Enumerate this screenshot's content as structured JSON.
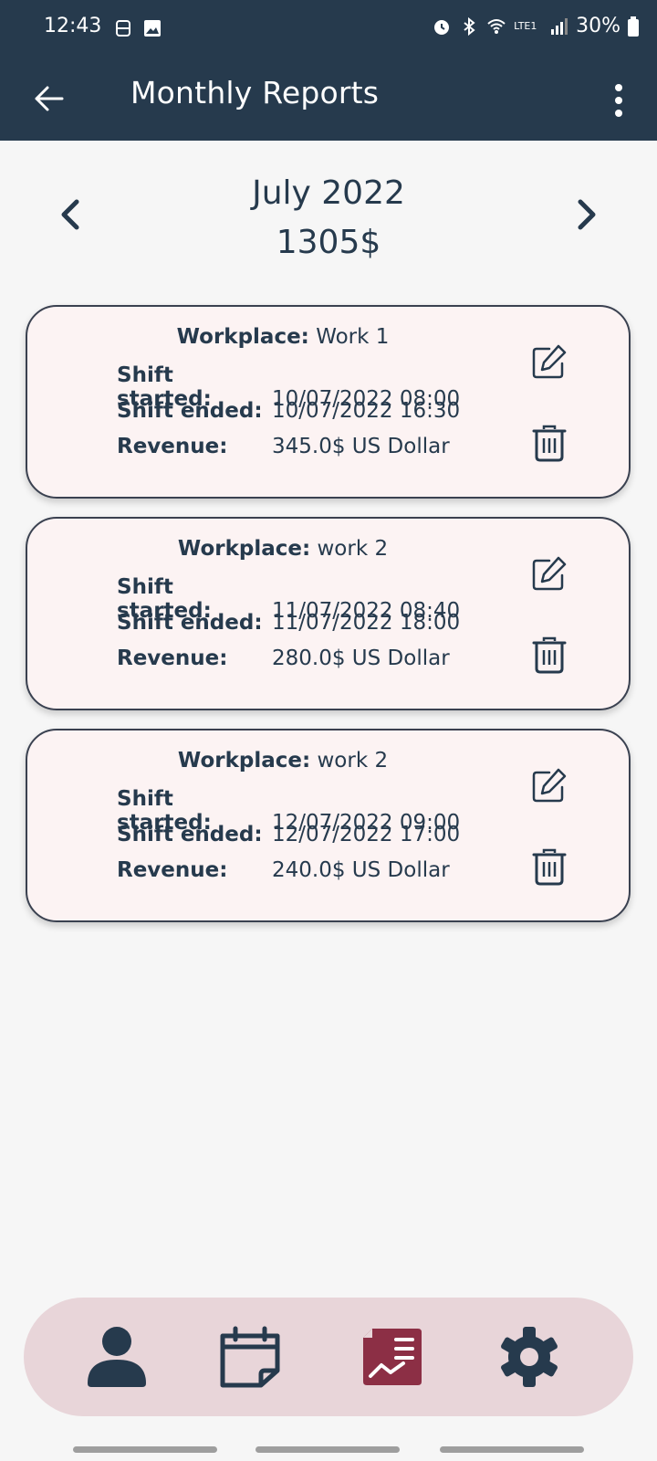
{
  "status_bar": {
    "time": "12:43",
    "battery": "30%",
    "net": "LTE1"
  },
  "app_bar": {
    "title": "Monthly Reports"
  },
  "month_nav": {
    "month": "July 2022",
    "total": "1305$"
  },
  "labels": {
    "workplace": "Workplace:",
    "shift_started": "Shift started:",
    "shift_ended": "Shift ended:",
    "revenue": "Revenue:"
  },
  "shifts": [
    {
      "workplace": "Work 1",
      "started": "10/07/2022  08:00",
      "ended": "10/07/2022  16:30",
      "revenue": "345.0$  US Dollar"
    },
    {
      "workplace": "work 2",
      "started": "11/07/2022  08:40",
      "ended": "11/07/2022  18:00",
      "revenue": "280.0$  US Dollar"
    },
    {
      "workplace": "work 2",
      "started": "12/07/2022  09:00",
      "ended": "12/07/2022  17:00",
      "revenue": "240.0$  US Dollar"
    }
  ],
  "bottom_nav": {
    "tabs": [
      {
        "icon": "person-icon",
        "active": false
      },
      {
        "icon": "calendar-icon",
        "active": false
      },
      {
        "icon": "reports-icon",
        "active": true
      },
      {
        "icon": "settings-icon",
        "active": false
      }
    ]
  },
  "colors": {
    "primary": "#263a4d",
    "card_bg": "#fcf3f3",
    "nav_bg": "#e8d5d9",
    "active_tab": "#8c2f45"
  }
}
